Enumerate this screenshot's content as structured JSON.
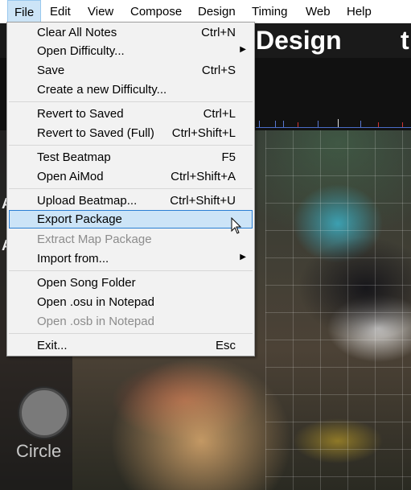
{
  "menubar": {
    "items": [
      "File",
      "Edit",
      "View",
      "Compose",
      "Design",
      "Timing",
      "Web",
      "Help"
    ],
    "open_menu": "File"
  },
  "editor": {
    "tab_design": "Design",
    "tab_timing_partial": "t",
    "left_letters": [
      "A",
      "A"
    ],
    "tool_circle_label": "Circle"
  },
  "file_menu": {
    "items": [
      {
        "label": "Clear All Notes",
        "shortcut": "Ctrl+N",
        "enabled": true
      },
      {
        "label": "Open Difficulty...",
        "shortcut": "",
        "submenu": true,
        "enabled": true
      },
      {
        "label": "Save",
        "shortcut": "Ctrl+S",
        "enabled": true
      },
      {
        "label": "Create a new Difficulty...",
        "shortcut": "",
        "enabled": true
      },
      {
        "label": "Revert to Saved",
        "shortcut": "Ctrl+L",
        "enabled": true
      },
      {
        "label": "Revert to Saved (Full)",
        "shortcut": "Ctrl+Shift+L",
        "enabled": true
      },
      {
        "label": "Test Beatmap",
        "shortcut": "F5",
        "enabled": true
      },
      {
        "label": "Open AiMod",
        "shortcut": "Ctrl+Shift+A",
        "enabled": true
      },
      {
        "label": "Upload Beatmap...",
        "shortcut": "Ctrl+Shift+U",
        "enabled": true
      },
      {
        "label": "Export Package",
        "shortcut": "",
        "enabled": true,
        "highlighted": true
      },
      {
        "label": "Extract Map Package",
        "shortcut": "",
        "enabled": false
      },
      {
        "label": "Import from...",
        "shortcut": "",
        "submenu": true,
        "enabled": true
      },
      {
        "label": "Open Song Folder",
        "shortcut": "",
        "enabled": true
      },
      {
        "label": "Open .osu in Notepad",
        "shortcut": "",
        "enabled": true
      },
      {
        "label": "Open .osb in Notepad",
        "shortcut": "",
        "enabled": false
      },
      {
        "label": "Exit...",
        "shortcut": "Esc",
        "enabled": true
      }
    ]
  },
  "icons": {
    "submenu_arrow": "▶"
  },
  "colors": {
    "highlight_bg": "#cce4f7",
    "highlight_border": "#2a7fd4",
    "disabled_text": "#8c8c8c"
  }
}
